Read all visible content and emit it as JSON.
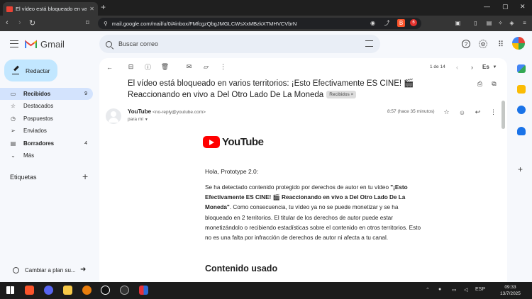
{
  "browser": {
    "tab_title": "El vídeo está bloqueado en vario",
    "url": "mail.google.com/mail/u/0/#inbox/FMfcgzQbgJMGLCWsXxMBzkXTMHVCVbrN",
    "brave_badge": "6"
  },
  "gmail": {
    "brand": "Gmail",
    "search_placeholder": "Buscar correo",
    "compose_label": "Redactar",
    "sidebar": [
      {
        "label": "Recibidos",
        "count": "9",
        "icon": "inbox-icon",
        "active": true
      },
      {
        "label": "Destacados",
        "count": "",
        "icon": "star-icon"
      },
      {
        "label": "Pospuestos",
        "count": "",
        "icon": "clock-icon"
      },
      {
        "label": "Enviados",
        "count": "",
        "icon": "send-icon"
      },
      {
        "label": "Borradores",
        "count": "4",
        "icon": "draft-icon"
      },
      {
        "label": "Más",
        "count": "",
        "icon": "chevron-down-icon"
      }
    ],
    "labels_header": "Etiquetas",
    "upgrade_label": "Cambiar a plan su..."
  },
  "message": {
    "pager": "1 de 14",
    "lang": "Es",
    "subject": "El vídeo está bloqueado en varios territorios: ¡Esto Efectivamente ES CINE! 🎬 Reaccionando en vivo a Del Otro Lado De La Moneda",
    "label_chip": "Recibidos ×",
    "sender_name": "YouTube",
    "sender_email": "<no-reply@youtube.com>",
    "to": "para mí",
    "time": "8:57 (hace 35 minutos)"
  },
  "email_body": {
    "brand": "YouTube",
    "greeting": "Hola, Prototype 2.0:",
    "p1_a": "Se ha detectado contenido protegido por derechos de autor en tu vídeo ",
    "p1_title": "\"¡Esto Efectivamente ES CINE! 🎬 Reaccionando en vivo a Del Otro Lado De La Moneda\"",
    "p1_b": ". Como consecuencia, tu vídeo ya no se puede monetizar y se ha bloqueado en 2 territorios. El titular de los derechos de autor puede estar monetizándolo o recibiendo estadísticas sobre el contenido en otros territorios. Esto no es una falta por infracción de derechos de autor ni afecta a tu canal.",
    "section_title": "Contenido usado"
  },
  "taskbar": {
    "lang": "ESP",
    "time": "09:33",
    "date": "13/7/2025"
  }
}
